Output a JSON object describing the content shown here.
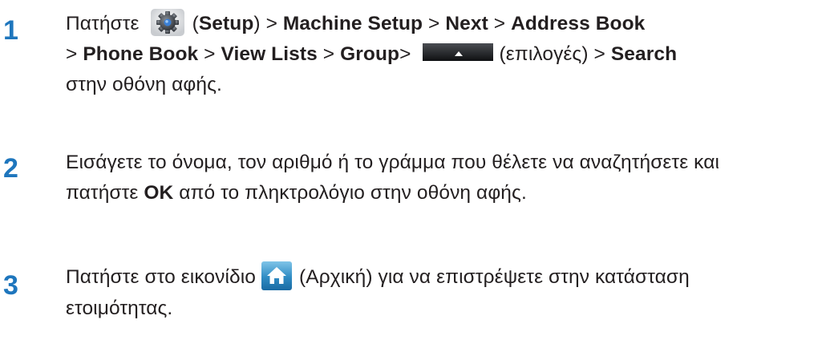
{
  "steps": [
    {
      "number": "1",
      "parts": {
        "p1": "Πατήστε",
        "p2": "(",
        "setup": "Setup",
        "p3": ") > ",
        "machine_setup": "Machine Setup",
        "p4": " > ",
        "next": "Next",
        "p5": " > ",
        "address_book": "Address Book",
        "p6": "> ",
        "phone_book": "Phone Book",
        "p7": " > ",
        "view_lists": "View Lists",
        "p8": " > ",
        "group": "Group",
        "p9": ">",
        "p10": "(επιλογές) > ",
        "search": "Search",
        "p11": "στην οθόνη αφής."
      }
    },
    {
      "number": "2",
      "parts": {
        "p1": "Εισάγετε το όνομα, τον αριθμό ή το γράμμα που θέλετε να αναζητήσετε και πατήστε ",
        "ok": "OK",
        "p2": " από το πληκτρολόγιο στην οθόνη αφής."
      }
    },
    {
      "number": "3",
      "parts": {
        "p1": "Πατήστε στο εικονίδιο",
        "p2": "(Αρχική) για να επιστρέψετε στην κατάσταση ετοιμότητας."
      }
    }
  ],
  "icons": {
    "setup": "gear-icon",
    "options": "options-button-icon",
    "home": "home-icon"
  },
  "colors": {
    "step_number": "#1e76bd",
    "text": "#231f20"
  }
}
